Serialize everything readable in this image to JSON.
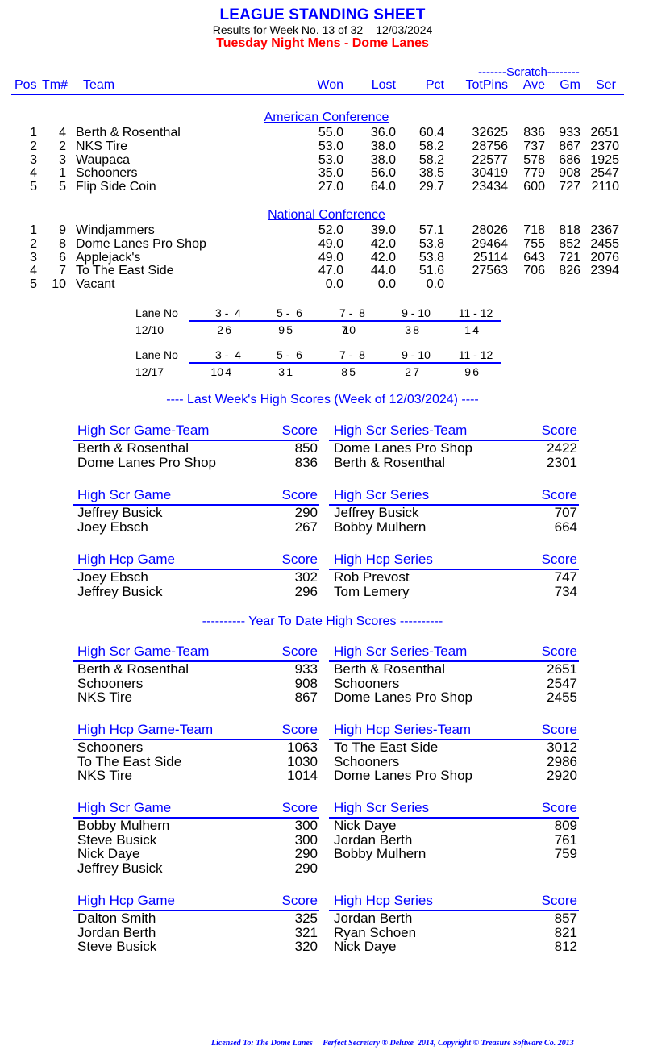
{
  "header": {
    "title": "LEAGUE STANDING SHEET",
    "week_text": "Results for Week No. 13 of 32",
    "date": "12/03/2024",
    "league_name": "Tuesday Night Mens - Dome Lanes"
  },
  "columns": {
    "scratch_label": "-------Scratch--------",
    "pos": "Pos",
    "tm": "Tm#",
    "team": "Team",
    "won": "Won",
    "lost": "Lost",
    "pct": "Pct",
    "totpins": "TotPins",
    "ave": "Ave",
    "gm": "Gm",
    "ser": "Ser"
  },
  "conferences": [
    {
      "name": "American Conference",
      "rows": [
        {
          "pos": "1",
          "tm": "4",
          "team": "Berth & Rosenthal",
          "won": "55.0",
          "lost": "36.0",
          "pct": "60.4",
          "totpins": "32625",
          "ave": "836",
          "gm": "933",
          "ser": "2651"
        },
        {
          "pos": "2",
          "tm": "2",
          "team": "NKS Tire",
          "won": "53.0",
          "lost": "38.0",
          "pct": "58.2",
          "totpins": "28756",
          "ave": "737",
          "gm": "867",
          "ser": "2370"
        },
        {
          "pos": "3",
          "tm": "3",
          "team": "Waupaca",
          "won": "53.0",
          "lost": "38.0",
          "pct": "58.2",
          "totpins": "22577",
          "ave": "578",
          "gm": "686",
          "ser": "1925"
        },
        {
          "pos": "4",
          "tm": "1",
          "team": "Schooners",
          "won": "35.0",
          "lost": "56.0",
          "pct": "38.5",
          "totpins": "30419",
          "ave": "779",
          "gm": "908",
          "ser": "2547"
        },
        {
          "pos": "5",
          "tm": "5",
          "team": "Flip Side Coin",
          "won": "27.0",
          "lost": "64.0",
          "pct": "29.7",
          "totpins": "23434",
          "ave": "600",
          "gm": "727",
          "ser": "2110"
        }
      ]
    },
    {
      "name": "National Conference",
      "rows": [
        {
          "pos": "1",
          "tm": "9",
          "team": "Windjammers",
          "won": "52.0",
          "lost": "39.0",
          "pct": "57.1",
          "totpins": "28026",
          "ave": "718",
          "gm": "818",
          "ser": "2367"
        },
        {
          "pos": "2",
          "tm": "8",
          "team": "Dome Lanes Pro Shop",
          "won": "49.0",
          "lost": "42.0",
          "pct": "53.8",
          "totpins": "29464",
          "ave": "755",
          "gm": "852",
          "ser": "2455"
        },
        {
          "pos": "3",
          "tm": "6",
          "team": "Applejack's",
          "won": "49.0",
          "lost": "42.0",
          "pct": "53.8",
          "totpins": "25114",
          "ave": "643",
          "gm": "721",
          "ser": "2076"
        },
        {
          "pos": "4",
          "tm": "7",
          "team": "To The East Side",
          "won": "47.0",
          "lost": "44.0",
          "pct": "51.6",
          "totpins": "27563",
          "ave": "706",
          "gm": "826",
          "ser": "2394"
        },
        {
          "pos": "5",
          "tm": "10",
          "team": "Vacant",
          "won": "0.0",
          "lost": "0.0",
          "pct": "0.0",
          "totpins": "",
          "ave": "",
          "gm": "",
          "ser": ""
        }
      ]
    }
  ],
  "lane_schedule": [
    {
      "label": "Lane No",
      "date": "12/10",
      "lanes": [
        "3 -  4",
        "5 -  6",
        "7 -  8",
        "9 - 10",
        "11 - 12"
      ],
      "pairs": [
        [
          "2",
          "6"
        ],
        [
          "9",
          "5"
        ],
        [
          "7",
          "10"
        ],
        [
          "3",
          "8"
        ],
        [
          "1",
          "4"
        ]
      ]
    },
    {
      "label": "Lane No",
      "date": "12/17",
      "lanes": [
        "3 -  4",
        "5 -  6",
        "7 -  8",
        "9 - 10",
        "11 - 12"
      ],
      "pairs": [
        [
          "10",
          "4"
        ],
        [
          "3",
          "1"
        ],
        [
          "8",
          "5"
        ],
        [
          "2",
          "7"
        ],
        [
          "9",
          "6"
        ]
      ]
    }
  ],
  "last_week": {
    "title": "----  Last Week's High Scores   (Week of 12/03/2024)  ----",
    "boxes": [
      {
        "title": "High Scr Game-Team",
        "score_label": "Score",
        "rows": [
          {
            "name": "Berth & Rosenthal",
            "score": "850"
          },
          {
            "name": "Dome Lanes Pro Shop",
            "score": "836"
          }
        ]
      },
      {
        "title": "High Scr Series-Team",
        "score_label": "Score",
        "rows": [
          {
            "name": "Dome Lanes Pro Shop",
            "score": "2422"
          },
          {
            "name": "Berth & Rosenthal",
            "score": "2301"
          }
        ]
      },
      {
        "title": "High Scr Game",
        "score_label": "Score",
        "rows": [
          {
            "name": "Jeffrey Busick",
            "score": "290"
          },
          {
            "name": "Joey Ebsch",
            "score": "267"
          }
        ]
      },
      {
        "title": "High Scr Series",
        "score_label": "Score",
        "rows": [
          {
            "name": "Jeffrey Busick",
            "score": "707"
          },
          {
            "name": "Bobby Mulhern",
            "score": "664"
          }
        ]
      },
      {
        "title": "High Hcp Game",
        "score_label": "Score",
        "rows": [
          {
            "name": "Joey Ebsch",
            "score": "302"
          },
          {
            "name": "Jeffrey Busick",
            "score": "296"
          }
        ]
      },
      {
        "title": "High Hcp Series",
        "score_label": "Score",
        "rows": [
          {
            "name": "Rob Prevost",
            "score": "747"
          },
          {
            "name": "Tom Lemery",
            "score": "734"
          }
        ]
      }
    ]
  },
  "year_to_date": {
    "title": "---------- Year To Date High Scores ----------",
    "boxes": [
      {
        "title": "High Scr Game-Team",
        "score_label": "Score",
        "rows": [
          {
            "name": "Berth & Rosenthal",
            "score": "933"
          },
          {
            "name": "Schooners",
            "score": "908"
          },
          {
            "name": "NKS Tire",
            "score": "867"
          }
        ]
      },
      {
        "title": "High Scr Series-Team",
        "score_label": "Score",
        "rows": [
          {
            "name": "Berth & Rosenthal",
            "score": "2651"
          },
          {
            "name": "Schooners",
            "score": "2547"
          },
          {
            "name": "Dome Lanes Pro Shop",
            "score": "2455"
          }
        ]
      },
      {
        "title": "High Hcp Game-Team",
        "score_label": "Score",
        "rows": [
          {
            "name": "Schooners",
            "score": "1063"
          },
          {
            "name": "To The East Side",
            "score": "1030"
          },
          {
            "name": "NKS Tire",
            "score": "1014"
          }
        ]
      },
      {
        "title": "High Hcp Series-Team",
        "score_label": "Score",
        "rows": [
          {
            "name": "To The East Side",
            "score": "3012"
          },
          {
            "name": "Schooners",
            "score": "2986"
          },
          {
            "name": "Dome Lanes Pro Shop",
            "score": "2920"
          }
        ]
      },
      {
        "title": "High Scr Game",
        "score_label": "Score",
        "rows": [
          {
            "name": "Bobby Mulhern",
            "score": "300"
          },
          {
            "name": "Steve Busick",
            "score": "300"
          },
          {
            "name": "Nick Daye",
            "score": "290"
          },
          {
            "name": "Jeffrey Busick",
            "score": "290"
          }
        ]
      },
      {
        "title": "High Scr Series",
        "score_label": "Score",
        "rows": [
          {
            "name": "Nick Daye",
            "score": "809"
          },
          {
            "name": "Jordan Berth",
            "score": "761"
          },
          {
            "name": "Bobby Mulhern",
            "score": "759"
          }
        ]
      },
      {
        "title": "High Hcp Game",
        "score_label": "Score",
        "rows": [
          {
            "name": "Dalton Smith",
            "score": "325"
          },
          {
            "name": "Jordan Berth",
            "score": "321"
          },
          {
            "name": "Steve Busick",
            "score": "320"
          }
        ]
      },
      {
        "title": "High Hcp Series",
        "score_label": "Score",
        "rows": [
          {
            "name": "Jordan Berth",
            "score": "857"
          },
          {
            "name": "Ryan Schoen",
            "score": "821"
          },
          {
            "name": "Nick Daye",
            "score": "812"
          }
        ]
      }
    ]
  },
  "footer": {
    "licensed": "Licensed To: The Dome Lanes",
    "product": "Perfect Secretary ® Deluxe  2014, Copyright © Treasure Software Co. 2013"
  }
}
